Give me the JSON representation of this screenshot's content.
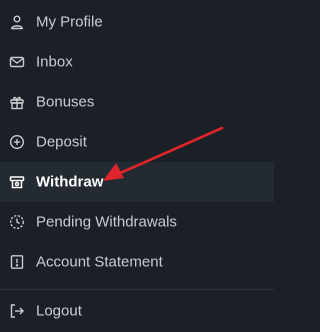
{
  "menu": {
    "items": [
      {
        "label": "My Profile",
        "icon": "user-icon"
      },
      {
        "label": "Inbox",
        "icon": "mail-icon"
      },
      {
        "label": "Bonuses",
        "icon": "gift-icon"
      },
      {
        "label": "Deposit",
        "icon": "plus-circle-icon"
      },
      {
        "label": "Withdraw",
        "icon": "withdraw-icon"
      },
      {
        "label": "Pending Withdrawals",
        "icon": "pending-clock-icon"
      },
      {
        "label": "Account Statement",
        "icon": "statement-icon"
      }
    ],
    "logout": {
      "label": "Logout",
      "icon": "logout-icon"
    },
    "active_item": "Withdraw"
  },
  "colors": {
    "background": "#1b2026",
    "active_background": "#232a31",
    "text": "#c9cdd2",
    "active_text": "#ffffff",
    "annotation_arrow": "#e0242b"
  }
}
